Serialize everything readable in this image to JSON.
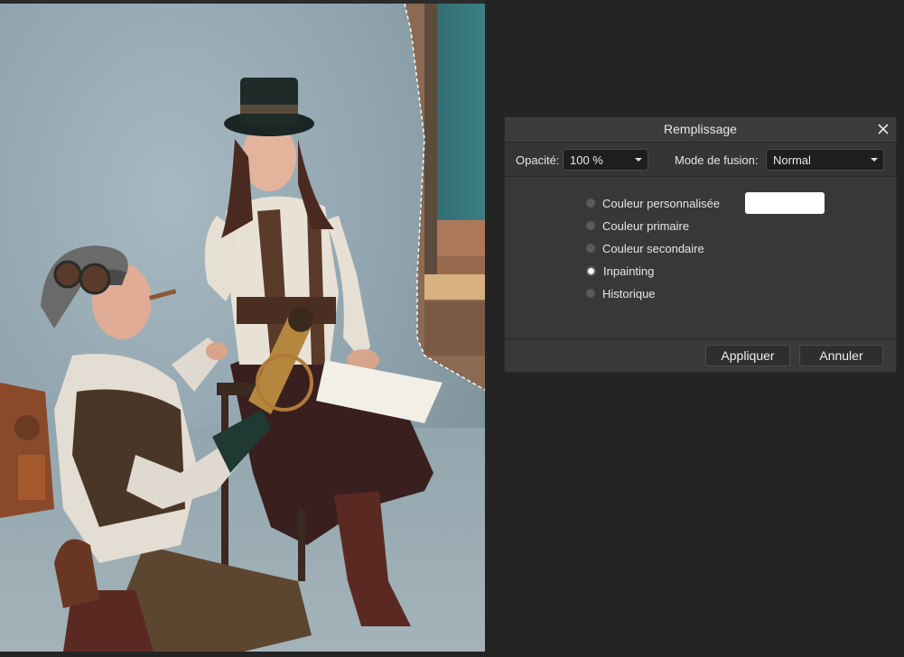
{
  "dialog": {
    "title": "Remplissage",
    "close_icon": "close-icon",
    "opacity_label": "Opacité:",
    "opacity_value": "100 %",
    "blend_label": "Mode de fusion:",
    "blend_value": "Normal",
    "options": [
      {
        "label": "Couleur personnalisée",
        "checked": false
      },
      {
        "label": "Couleur primaire",
        "checked": false
      },
      {
        "label": "Couleur secondaire",
        "checked": false
      },
      {
        "label": "Inpainting",
        "checked": true
      },
      {
        "label": "Historique",
        "checked": false
      }
    ],
    "custom_color": "#ffffff",
    "apply_label": "Appliquer",
    "cancel_label": "Annuler"
  },
  "colors": {
    "workspace_bg": "#242424",
    "dialog_bg": "#383838",
    "selection_outline": "#ffffff"
  }
}
